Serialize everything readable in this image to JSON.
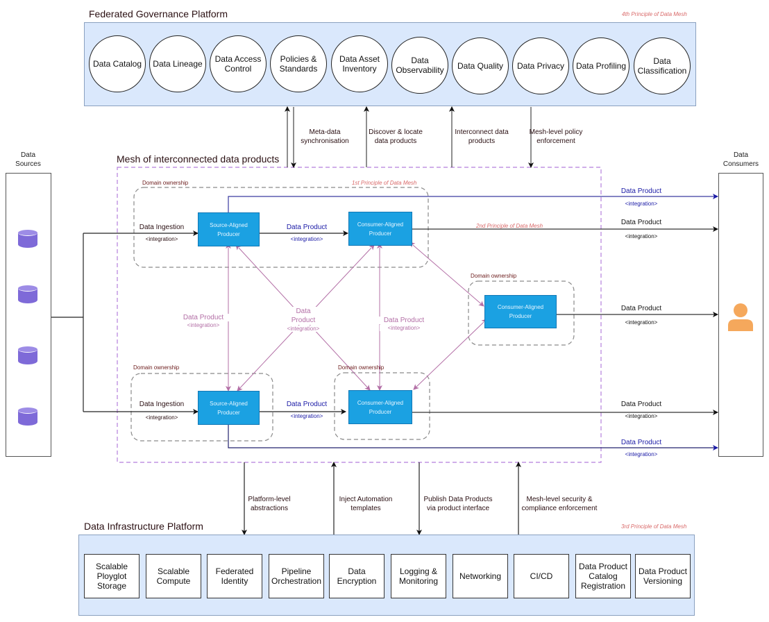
{
  "governance": {
    "title": "Federated Governance Platform",
    "principle": "4th Principle of Data Mesh",
    "items": [
      "Data Catalog",
      "Data Lineage",
      "Data Access\nControl",
      "Policies &\nStandards",
      "Data Asset\nInventory",
      "Data\nObservability",
      "Data Quality",
      "Data Privacy",
      "Data Profiling",
      "Data\nClassification"
    ]
  },
  "governance_links": [
    {
      "label": "Meta-data\nsynchronisation",
      "direction": "bidirectional"
    },
    {
      "label": "Discover & locate\ndata products",
      "direction": "up"
    },
    {
      "label": "Interconnect data\nproducts",
      "direction": "up"
    },
    {
      "label": "Mesh-level policy\nenforcement",
      "direction": "down"
    }
  ],
  "mesh": {
    "title": "Mesh of interconnected data products",
    "principle_1": "1st Principle of Data Mesh",
    "principle_2": "2nd Principle of Data Mesh",
    "domain_label": "Domain ownership",
    "producers": {
      "source_top": "Source-Aligned\nProducer",
      "consumer_top": "Consumer-Aligned\nProducer",
      "consumer_mid": "Consumer-Aligned\nProducer",
      "source_bottom": "Source-Aligned\nProducer",
      "consumer_bottom": "Consumer-Aligned\nProducer"
    },
    "edges": {
      "ingestion": "Data Ingestion",
      "integration": "<integration>",
      "data_product": "Data Product",
      "data_product_split": "Data\nProduct"
    }
  },
  "sources": {
    "title": "Data\nSources",
    "icon": "database-icon",
    "count": 4
  },
  "consumers": {
    "title": "Data\nConsumers",
    "icon": "user-icon"
  },
  "infra_links": [
    {
      "label": "Platform-level\nabstractions",
      "direction": "down"
    },
    {
      "label": "Inject Automation\ntemplates",
      "direction": "up"
    },
    {
      "label": "Publish Data Products\nvia product interface",
      "direction": "down"
    },
    {
      "label": "Mesh-level security &\ncompliance enforcement",
      "direction": "up"
    }
  ],
  "infrastructure": {
    "title": "Data Infrastructure Platform",
    "principle": "3rd Principle of Data Mesh",
    "items": [
      "Scalable\nPloyglot\nStorage",
      "Scalable\nCompute",
      "Federated\nIdentity",
      "Pipeline\nOrchestration",
      "Data\nEncryption",
      "Logging &\nMonitoring",
      "Networking",
      "CI/CD",
      "Data Product\nCatalog\nRegistration",
      "Data Product\nVersioning"
    ]
  },
  "colors": {
    "panel": "#dae8fc",
    "producer": "#1ba1e2",
    "mesh_border": "#b57edc",
    "domain_border": "#8a8a8a",
    "blue_link": "#1a1aa6",
    "pink_link": "#b36fa6",
    "database": "#7e6ad8",
    "user": "#f5a85c",
    "principle": "#d96a6a"
  }
}
